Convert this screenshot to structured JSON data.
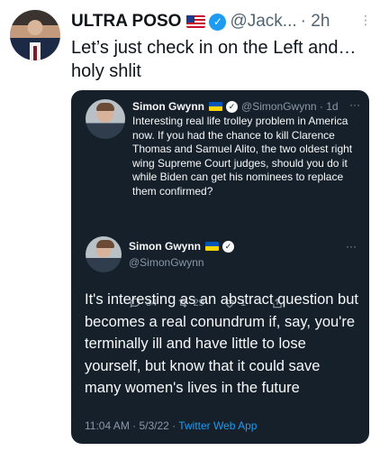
{
  "outer": {
    "name": "ULTRA POSO",
    "handle": "@Jack...",
    "time": "· 2h",
    "text": "Let’s just check in on the Left and…holy shlit"
  },
  "quote": {
    "name": "Simon Gwynn",
    "handle": "@SimonGwynn · 1d",
    "text": "Interesting real life trolley problem in America now. If you had the chance to kill Clarence Thomas and Samuel Alito, the two oldest right wing Supreme Court judges, should you do it while Biden can get his nominees to replace them confirmed?",
    "replies": "34",
    "retweets": "29",
    "likes": "1"
  },
  "reply": {
    "name": "Simon Gwynn",
    "handle": "@SimonGwynn",
    "text": "It's interesting as an abstract question but becomes a real conundrum if, say, you're terminally ill and have little to lose yourself, but know that it could save many women's lives in the future",
    "meta_prefix": "11:04 AM · 5/3/22 · ",
    "app": "Twitter Web App"
  },
  "colors": {
    "card_bg": "#15202b",
    "accent": "#1d9bf0"
  }
}
